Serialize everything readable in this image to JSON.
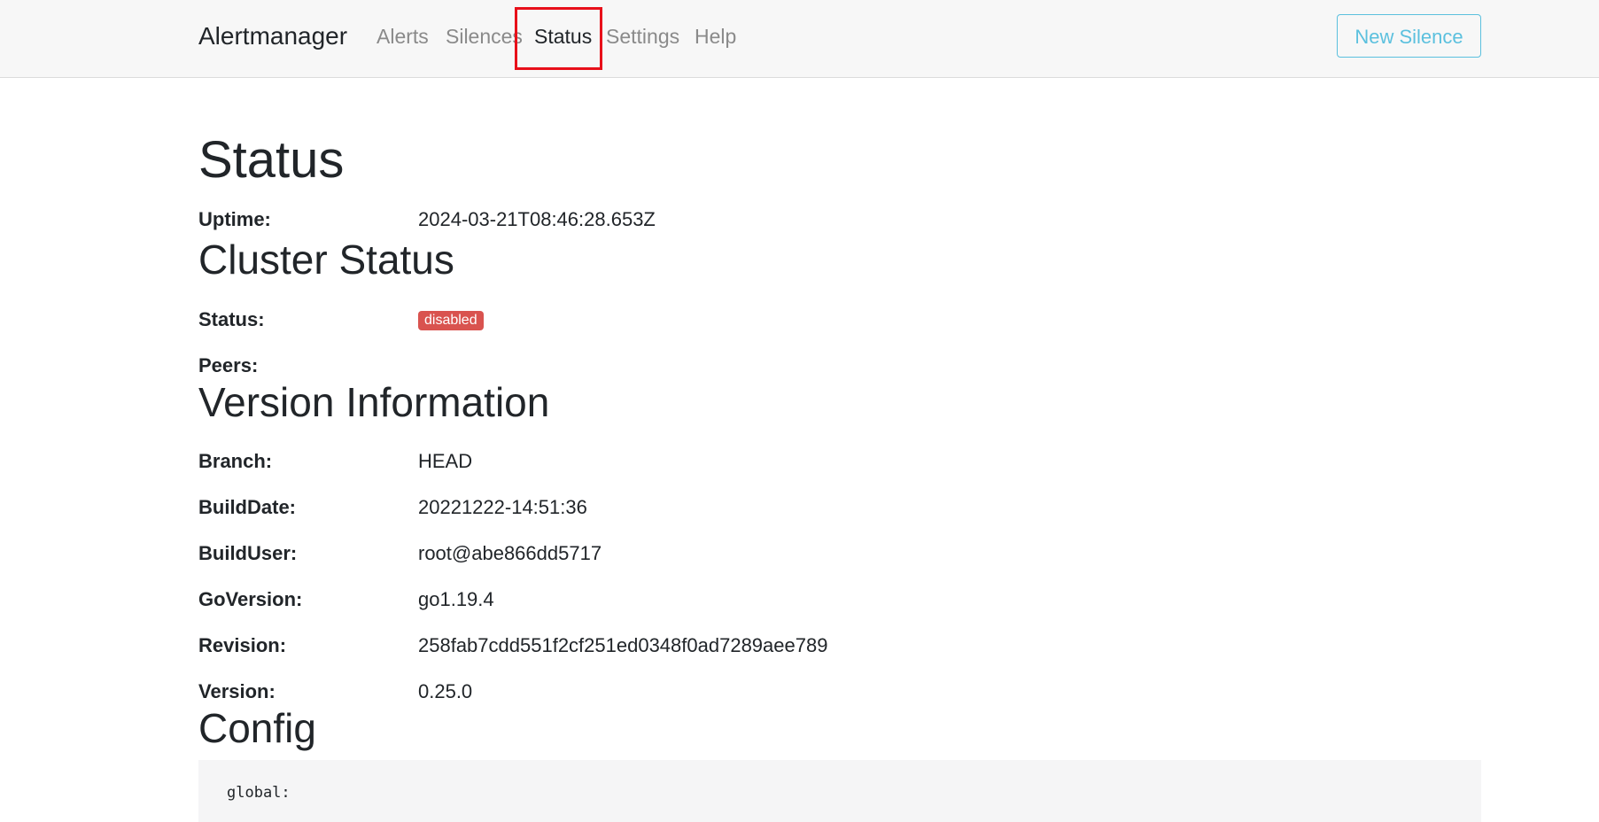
{
  "navbar": {
    "brand": "Alertmanager",
    "links": [
      {
        "label": "Alerts",
        "active": false
      },
      {
        "label": "Silences",
        "active": false
      },
      {
        "label": "Status",
        "active": true
      },
      {
        "label": "Settings",
        "active": false
      },
      {
        "label": "Help",
        "active": false
      }
    ],
    "new_silence_label": "New Silence"
  },
  "status": {
    "title": "Status",
    "uptime_label": "Uptime:",
    "uptime_value": "2024-03-21T08:46:28.653Z"
  },
  "cluster": {
    "title": "Cluster Status",
    "status_label": "Status:",
    "status_badge": "disabled",
    "peers_label": "Peers:"
  },
  "version": {
    "title": "Version Information",
    "rows": [
      {
        "label": "Branch:",
        "value": "HEAD"
      },
      {
        "label": "BuildDate:",
        "value": "20221222-14:51:36"
      },
      {
        "label": "BuildUser:",
        "value": "root@abe866dd5717"
      },
      {
        "label": "GoVersion:",
        "value": "go1.19.4"
      },
      {
        "label": "Revision:",
        "value": "258fab7cdd551f2cf251ed0348f0ad7289aee789"
      },
      {
        "label": "Version:",
        "value": "0.25.0"
      }
    ]
  },
  "config": {
    "title": "Config",
    "text": "global:"
  },
  "colors": {
    "accent_info": "#5bc0de",
    "badge_danger": "#d9534f",
    "highlight": "#e8101a"
  }
}
